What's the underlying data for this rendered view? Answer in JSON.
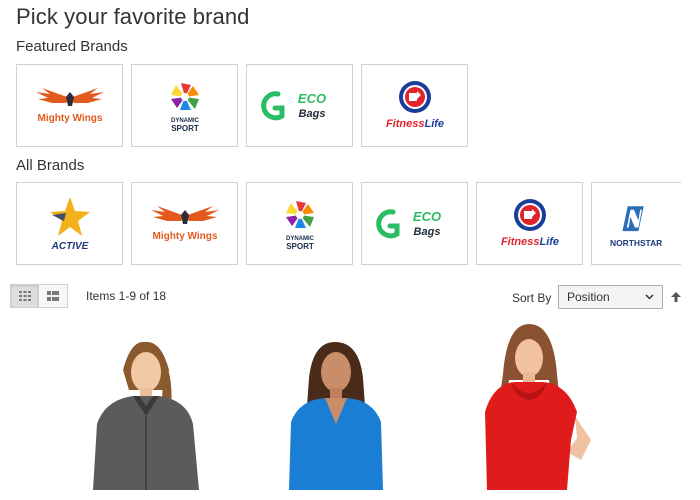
{
  "page": {
    "title": "Pick your favorite brand"
  },
  "featured": {
    "title": "Featured Brands",
    "brands": [
      {
        "name": "Mighty Wings"
      },
      {
        "line1": "DYNAMIC",
        "line2": "SPORT"
      },
      {
        "line1": "ECO",
        "line2": "Bags"
      },
      {
        "part1": "Fitness",
        "part2": "Life"
      }
    ]
  },
  "all": {
    "title": "All Brands",
    "brands": [
      {
        "name": "ACTIVE"
      },
      {
        "name": "Mighty Wings"
      },
      {
        "line1": "DYNAMIC",
        "line2": "SPORT"
      },
      {
        "line1": "ECO",
        "line2": "Bags"
      },
      {
        "part1": "Fitness",
        "part2": "Life"
      },
      {
        "name": "NORTHSTAR"
      }
    ]
  },
  "toolbar": {
    "items": "Items 1-9 of 18",
    "sort_label": "Sort By",
    "sort_value": "Position",
    "view_modes": [
      "grid",
      "list"
    ]
  },
  "products": [
    {
      "color": "#5b5b5b"
    },
    {
      "color": "#1a7fd4"
    },
    {
      "color": "#e01b1b"
    }
  ],
  "colors": {
    "wing_orange": "#e35a1e",
    "wing_dark": "#2c2c3a",
    "eco_green": "#2bbd63",
    "fitness_red": "#e0242b",
    "fitness_blue": "#1a3d9a",
    "active_yellow": "#f3b21b",
    "active_navy": "#1f3c7a",
    "northstar_blue": "#2c6db8"
  }
}
